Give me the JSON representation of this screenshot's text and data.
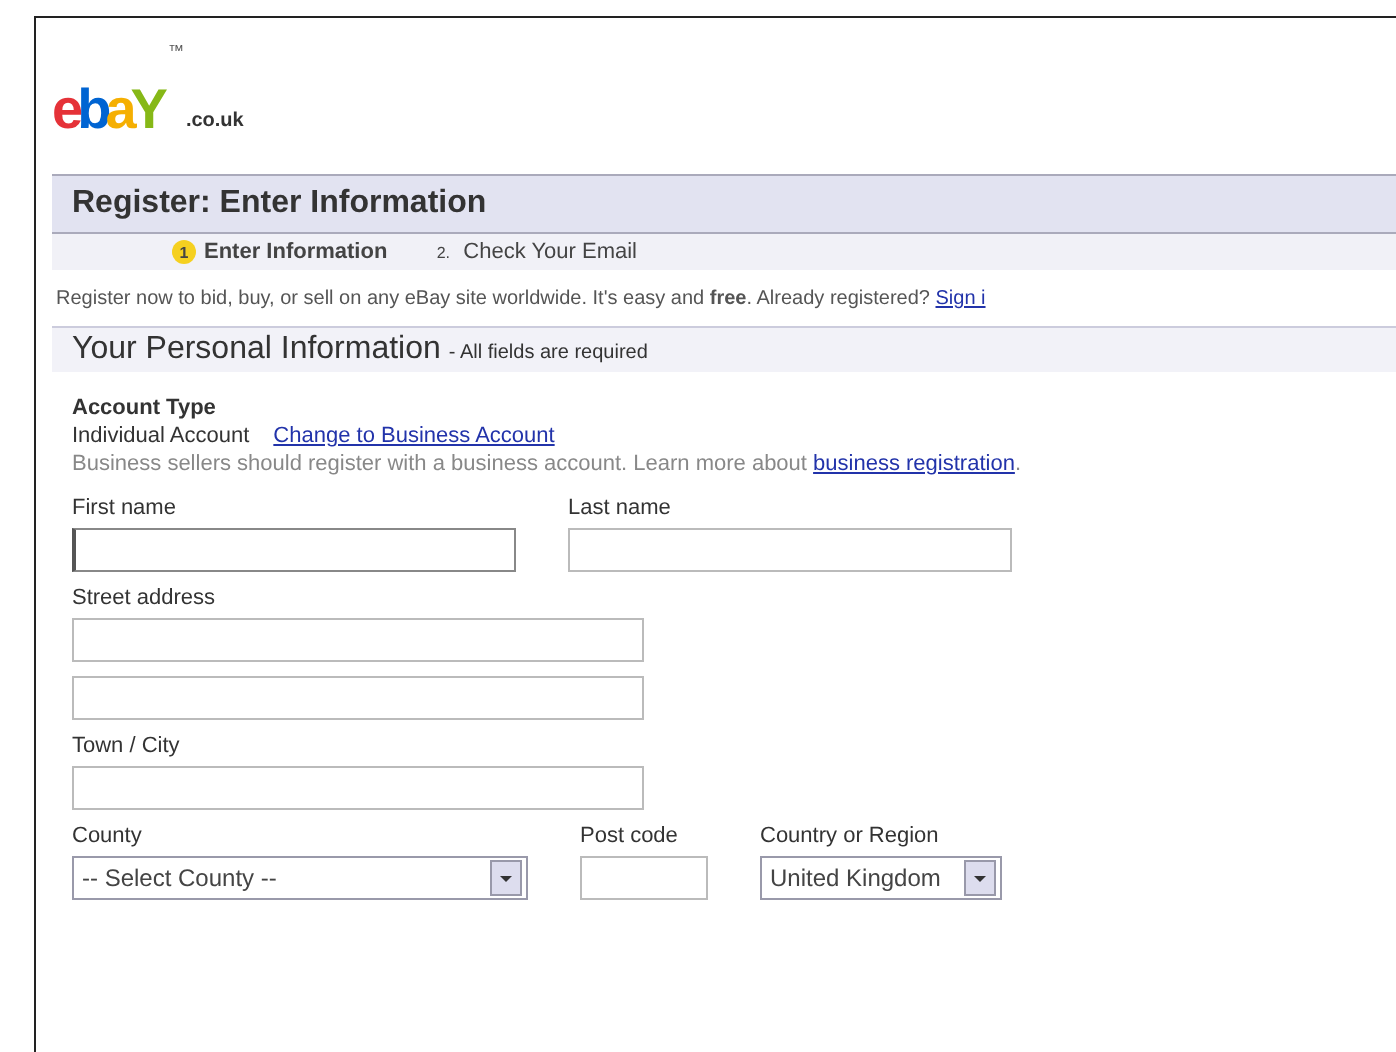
{
  "logo": {
    "letters": [
      {
        "char": "e",
        "color": "#e53238"
      },
      {
        "char": "b",
        "color": "#0064d2"
      },
      {
        "char": "a",
        "color": "#f5af02"
      },
      {
        "char": "Y",
        "color": "#86b817"
      }
    ],
    "trademark": "™",
    "domain": ".co.uk"
  },
  "page_title": "Register: Enter Information",
  "steps": [
    {
      "number": "1",
      "label": "Enter Information",
      "selected": true
    },
    {
      "number": "2.",
      "label": "Check Your Email",
      "selected": false
    }
  ],
  "intro": {
    "text": "Register now to bid, buy, or sell on any eBay site worldwide. It's easy and **free**. Already registered?",
    "link": "Sign i"
  },
  "section": {
    "title": "Your Personal Information",
    "note": "- All fields are required"
  },
  "account_type": {
    "label": "Account Type",
    "value": "Individual Account",
    "change_link": "Change to Business Account",
    "hint": "Business sellers should register with a business account. Learn more about",
    "hint_link": "business registration",
    "hint_end": "."
  },
  "fields": [
    {
      "row": [
        {
          "kind": "text",
          "label": "First name",
          "focused": true
        },
        {
          "kind": "text",
          "label": "Last name",
          "focused": false
        }
      ]
    },
    {
      "row": [
        {
          "kind": "text",
          "label": "Street address",
          "focused": false
        }
      ]
    },
    {
      "row": [
        {
          "kind": "text",
          "focused": false
        }
      ]
    },
    {
      "row": [
        {
          "kind": "text",
          "label": "Town / City",
          "focused": false
        }
      ]
    },
    {
      "row": [
        {
          "kind": "select",
          "label": "County",
          "value": "-- Select County --"
        },
        {
          "kind": "text",
          "label": "Post code",
          "focused": false
        },
        {
          "kind": "select",
          "label": "Country or Region",
          "value": "United Kingdom"
        }
      ]
    }
  ]
}
